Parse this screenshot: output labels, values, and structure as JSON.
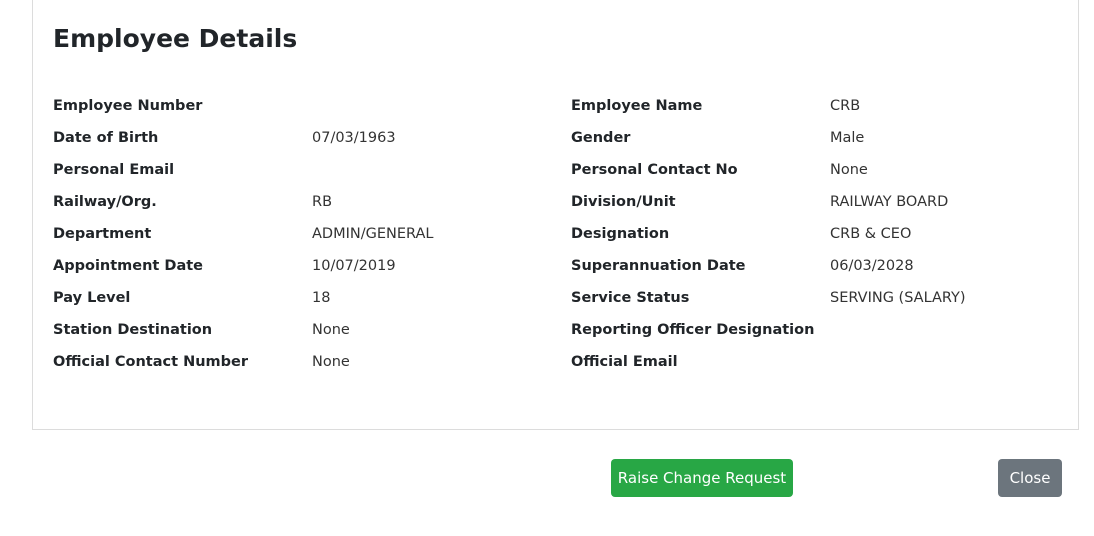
{
  "header": {
    "title": "Employee Details"
  },
  "details": {
    "rows": [
      {
        "l1": "Employee Number",
        "v1": "",
        "l2": "Employee Name",
        "v2": "CRB"
      },
      {
        "l1": "Date of Birth",
        "v1": "07/03/1963",
        "l2": "Gender",
        "v2": "Male"
      },
      {
        "l1": "Personal Email",
        "v1": "",
        "l2": "Personal Contact No",
        "v2": "None"
      },
      {
        "l1": "Railway/Org.",
        "v1": "RB",
        "l2": "Division/Unit",
        "v2": "RAILWAY BOARD"
      },
      {
        "l1": "Department",
        "v1": "ADMIN/GENERAL",
        "l2": "Designation",
        "v2": "CRB & CEO"
      },
      {
        "l1": "Appointment Date",
        "v1": "10/07/2019",
        "l2": "Superannuation Date",
        "v2": "06/03/2028"
      },
      {
        "l1": "Pay Level",
        "v1": "18",
        "l2": "Service Status",
        "v2": "SERVING (SALARY)"
      },
      {
        "l1": "Station Destination",
        "v1": "None",
        "l2": "Reporting Officer Designation",
        "v2": ""
      },
      {
        "l1": "Official Contact Number",
        "v1": "None",
        "l2": "Official Email",
        "v2": ""
      }
    ]
  },
  "actions": {
    "raise_label": "Raise Change Request",
    "close_label": "Close"
  },
  "colors": {
    "raise_button": "#28a745",
    "close_button": "#6c757d"
  }
}
